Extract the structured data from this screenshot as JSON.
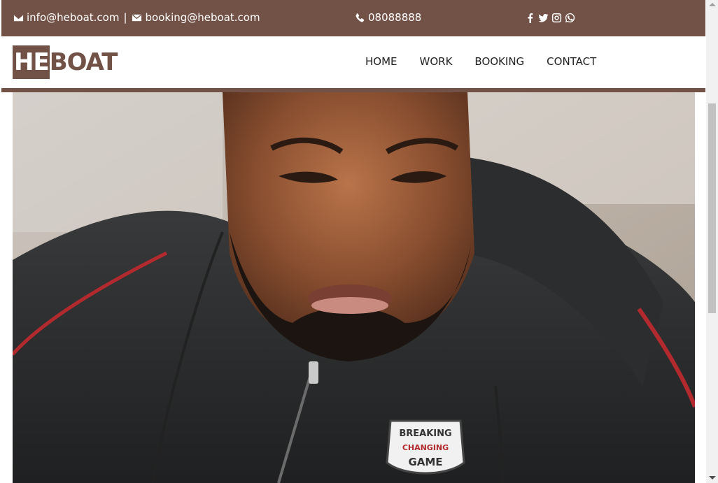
{
  "topbar": {
    "email_info": "info@heboat.com",
    "separator": "|",
    "email_booking": "booking@heboat.com",
    "phone": "08088888",
    "icons": [
      "envelope-icon",
      "envelope-icon",
      "phone-icon",
      "facebook-icon",
      "twitter-icon",
      "instagram-icon",
      "whatsapp-icon"
    ],
    "background_color": "#725246"
  },
  "brand": {
    "logo_part1": "HE",
    "logo_part2": "BOAT",
    "color": "#725246"
  },
  "nav": {
    "items": [
      {
        "label": "HOME"
      },
      {
        "label": "WORK"
      },
      {
        "label": "BOOKING"
      },
      {
        "label": "CONTACT"
      }
    ]
  },
  "hero": {
    "image_alt": "",
    "badge_lines": [
      "BREAKING",
      "CHANGING",
      "GAME"
    ]
  }
}
